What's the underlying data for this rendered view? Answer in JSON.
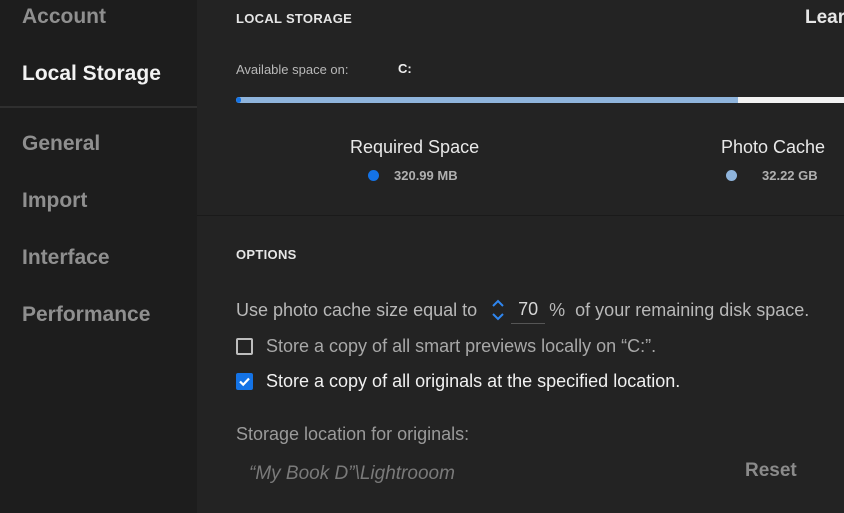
{
  "sidebar": {
    "items": [
      {
        "label": "Account"
      },
      {
        "label": "Local Storage"
      },
      {
        "label": "General"
      },
      {
        "label": "Import"
      },
      {
        "label": "Interface"
      },
      {
        "label": "Performance"
      }
    ],
    "active_index": 1
  },
  "local_storage": {
    "heading": "LOCAL STORAGE",
    "learn_link": "Lear",
    "available_label": "Available space on:",
    "drive": "C:",
    "usage_bar": {
      "required_fraction": 0.008,
      "photo_cache_fraction": 0.81
    },
    "legend": {
      "required": {
        "title": "Required Space",
        "value": "320.99 MB",
        "color": "#1473e6"
      },
      "photo_cache": {
        "title": "Photo Cache",
        "value": "32.22 GB",
        "color": "#8fb4dc"
      }
    }
  },
  "options": {
    "heading": "OPTIONS",
    "cache_prefix": "Use photo cache size equal to",
    "cache_value": "70",
    "cache_unit": "%",
    "cache_suffix": "of your remaining disk space.",
    "smart_previews": {
      "label": "Store a copy of all smart previews locally on “C:”.",
      "checked": false
    },
    "originals": {
      "label": "Store a copy of all originals at the specified location.",
      "checked": true
    },
    "location_label": "Storage location for originals:",
    "location_value": "“My Book D”\\Lightrooom",
    "reset_label": "Reset"
  },
  "colors": {
    "accent": "#1473e6",
    "cache": "#8fb4dc",
    "background": "#232323",
    "sidebar": "#1d1d1d"
  }
}
